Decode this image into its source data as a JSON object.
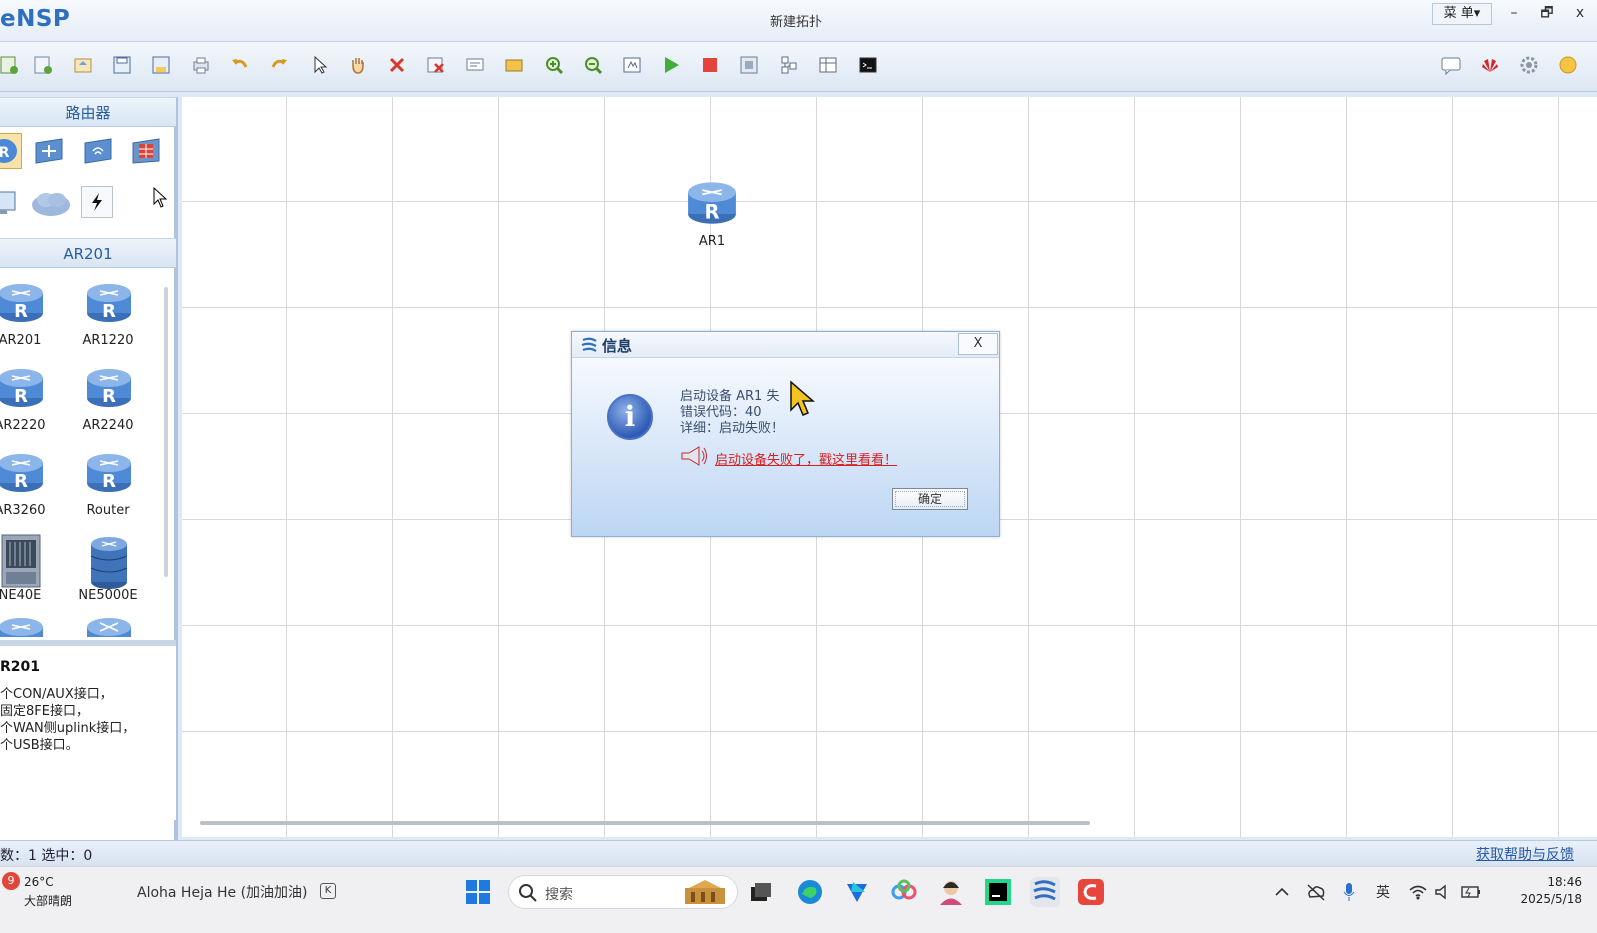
{
  "window": {
    "app_name": "eNSP",
    "title": "新建拓扑",
    "menu_label": "菜 单▾",
    "minimize": "–",
    "restore": "🗗",
    "close": "x"
  },
  "toolbar": {
    "buttons": [
      "new-topology-icon",
      "new-test-icon",
      "open-icon",
      "save-icon",
      "save-as-icon",
      "print-icon",
      "undo-icon",
      "redo-icon",
      "select-icon",
      "pan-hand-icon",
      "delete-icon",
      "delete-link-icon",
      "text-note-icon",
      "rectangle-icon",
      "zoom-in-icon",
      "zoom-out-icon",
      "fit-icon",
      "start-device-icon",
      "stop-device-icon",
      "capture-icon",
      "topology-icon",
      "grid-icon",
      "cli-icon"
    ],
    "right_buttons": [
      "chat-icon",
      "huawei-icon",
      "settings-icon",
      "help-icon"
    ]
  },
  "left_panel": {
    "category_header": "路由器",
    "categories": [
      "router-category-icon",
      "switch-category-icon",
      "wlan-category-icon",
      "firewall-category-icon",
      "pc-category-icon",
      "cloud-category-icon",
      "link-category-icon"
    ],
    "device_header": "AR201",
    "devices": [
      {
        "label": "AR201"
      },
      {
        "label": "AR1220"
      },
      {
        "label": "AR2220"
      },
      {
        "label": "AR2240"
      },
      {
        "label": "AR3260"
      },
      {
        "label": "Router"
      },
      {
        "label": "NE40E"
      },
      {
        "label": "NE5000E"
      }
    ],
    "description": {
      "title": "R201",
      "lines": [
        "个CON/AUX接口，",
        "固定8FE接口，",
        "个WAN侧uplink接口，",
        "个USB接口。"
      ]
    }
  },
  "canvas": {
    "node": {
      "label": "AR1"
    }
  },
  "dialog": {
    "title": "信息",
    "close_label": "X",
    "message_lines": [
      "启动设备 AR1 失",
      "错误代码：40",
      "详细：启动失败！"
    ],
    "help_link": "启动设备失败了，戳这里看看！",
    "ok_label": "确定"
  },
  "statusbar": {
    "counts": "数：1 选中：0",
    "help_link": "获取帮助与反馈"
  },
  "taskbar": {
    "weather_badge": "9",
    "temperature": "26°C",
    "weather": "大部晴朗",
    "now_playing": "Aloha Heja He (加油加油)",
    "media_icon": "K",
    "search_placeholder": "搜索",
    "apps": [
      "task-view-icon",
      "edge-icon",
      "feishu-icon",
      "baidu-netdisk-icon",
      "avatar-app-icon",
      "pycharm-icon",
      "ensp-icon",
      "red-app-icon"
    ],
    "tray": {
      "ime": "英"
    },
    "time": "18:46",
    "date": "2025/5/18"
  },
  "colors": {
    "accent": "#2e6fc0",
    "link_red": "#d81e1e",
    "panel_header": "#2a5d9c"
  }
}
